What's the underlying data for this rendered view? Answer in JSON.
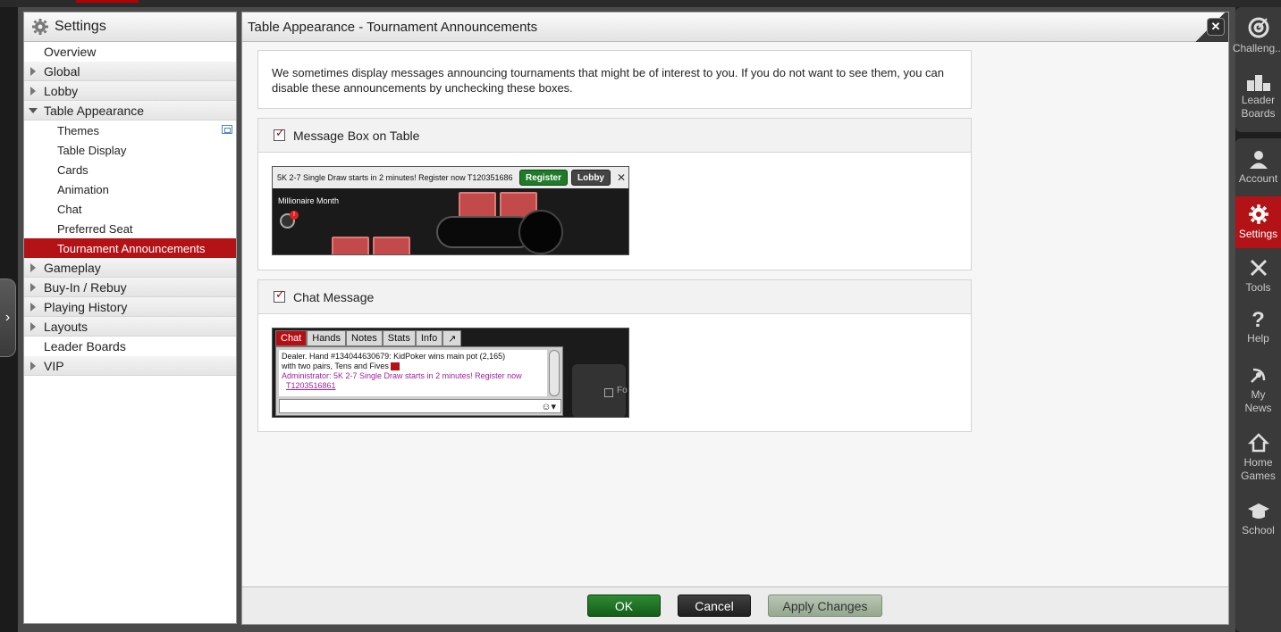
{
  "sidebar": {
    "title": "Settings",
    "items": [
      {
        "label": "Overview"
      },
      {
        "label": "Global"
      },
      {
        "label": "Lobby"
      },
      {
        "label": "Table Appearance"
      },
      {
        "label": "Themes"
      },
      {
        "label": "Table Display"
      },
      {
        "label": "Cards"
      },
      {
        "label": "Animation"
      },
      {
        "label": "Chat"
      },
      {
        "label": "Preferred Seat"
      },
      {
        "label": "Tournament Announcements"
      },
      {
        "label": "Gameplay"
      },
      {
        "label": "Buy-In / Rebuy"
      },
      {
        "label": "Playing History"
      },
      {
        "label": "Layouts"
      },
      {
        "label": "Leader Boards"
      },
      {
        "label": "VIP"
      }
    ]
  },
  "main": {
    "title": "Table Appearance - Tournament Announcements",
    "intro": "We sometimes display messages announcing tournaments that might be of interest to you. If you do not want to see them, you can disable these announcements by unchecking these boxes.",
    "sections": [
      {
        "label": "Message Box on Table",
        "checked": true
      },
      {
        "label": "Chat Message",
        "checked": true
      }
    ]
  },
  "preview1": {
    "message": "5K 2-7 Single Draw starts in 2 minutes! Register now T120351686",
    "register": "Register",
    "lobby": "Lobby",
    "close": "✕",
    "table_label": "Millionaire Month",
    "badge": "!"
  },
  "preview2": {
    "tabs": [
      "Chat",
      "Hands",
      "Notes",
      "Stats",
      "Info",
      "↗"
    ],
    "line1": "Dealer. Hand  #134044630679: KidPoker wins main pot (2,165)",
    "line2": " with two pairs, Tens and Fives",
    "admin": "Administrator: 5K 2-7 Single Draw starts in 2 minutes!  Register now",
    "admin_link": "T1203516861",
    "side_label": "Fo"
  },
  "footer": {
    "ok": "OK",
    "cancel": "Cancel",
    "apply": "Apply Changes"
  },
  "rightbar": {
    "items": [
      {
        "label": "Challeng..."
      },
      {
        "label": "Leader\nBoards"
      },
      {
        "label": "Account"
      },
      {
        "label": "Settings"
      },
      {
        "label": "Tools"
      },
      {
        "label": "Help"
      },
      {
        "label": "My\nNews"
      },
      {
        "label": "Home\nGames"
      },
      {
        "label": "School"
      }
    ]
  },
  "window": {
    "close": "✕"
  },
  "colors": {
    "accent": "#b31216",
    "ok": "#1f7a2a",
    "cancel": "#2a2a2a"
  }
}
